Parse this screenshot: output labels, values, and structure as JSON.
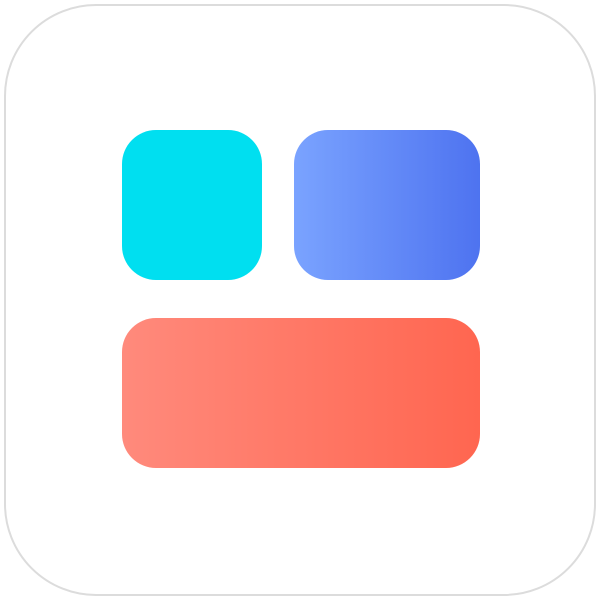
{
  "app_icon": {
    "name": "widget-layout-app-icon",
    "colors": {
      "frame_border": "#dcdcdc",
      "background": "#ffffff",
      "tile_top_left": "#00dff0",
      "tile_top_right_start": "#7aa3ff",
      "tile_top_right_end": "#4e73f0",
      "tile_bottom_start": "#ff8a7c",
      "tile_bottom_end": "#ff6650"
    }
  }
}
